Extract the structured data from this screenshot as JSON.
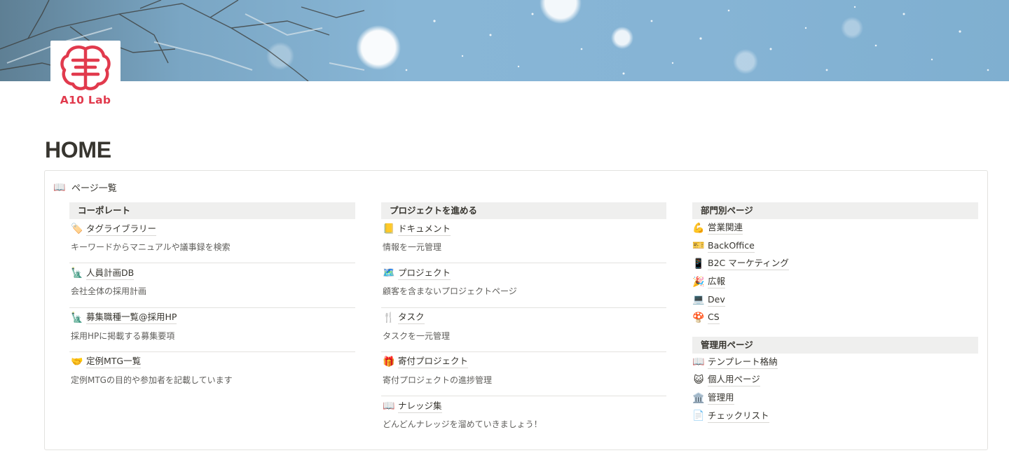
{
  "logo": {
    "text": "A10 Lab",
    "color": "#e13a4d"
  },
  "page": {
    "title": "HOME"
  },
  "overview": {
    "icon": "📖",
    "icon_name": "open-book-icon",
    "label": "ページ一覧"
  },
  "columns": [
    {
      "heading": "コーポレート",
      "items": [
        {
          "icon": "🏷️",
          "icon_name": "tag-icon",
          "title": "タグライブラリー",
          "desc": "キーワードからマニュアルや議事録を検索"
        },
        {
          "icon": "🗽",
          "icon_name": "statue-of-liberty-icon",
          "title": "人員計画DB",
          "desc": "会社全体の採用計画"
        },
        {
          "icon": "🗽",
          "icon_name": "statue-of-liberty-icon",
          "title": "募集職種一覧@採用HP",
          "desc": "採用HPに掲載する募集要項"
        },
        {
          "icon": "🤝",
          "icon_name": "handshake-icon",
          "title": "定例MTG一覧",
          "desc": "定例MTGの目的や参加者を記載しています"
        }
      ]
    },
    {
      "heading": "プロジェクトを進める",
      "items": [
        {
          "icon": "📒",
          "icon_name": "ledger-icon",
          "title": "ドキュメント",
          "desc": "情報を一元管理"
        },
        {
          "icon": "🗺️",
          "icon_name": "map-icon",
          "title": "プロジェクト",
          "desc": "顧客を含まないプロジェクトページ"
        },
        {
          "icon": "🍴",
          "icon_name": "fork-knife-icon",
          "title": "タスク",
          "desc": "タスクを一元管理"
        },
        {
          "icon": "🎁",
          "icon_name": "gift-icon",
          "title": "寄付プロジェクト",
          "desc": "寄付プロジェクトの進捗管理"
        },
        {
          "icon": "📖",
          "icon_name": "open-book-icon",
          "title": "ナレッジ集",
          "desc": "どんどんナレッジを溜めていきましょう！"
        }
      ]
    }
  ],
  "departments": {
    "heading": "部門別ページ",
    "links": [
      {
        "icon": "💪",
        "icon_name": "flexed-biceps-icon",
        "label": "営業関連"
      },
      {
        "icon": "🎫",
        "icon_name": "ticket-icon",
        "label": "BackOffice"
      },
      {
        "icon": "📱",
        "icon_name": "mobile-phone-icon",
        "label": "B2C マーケティング"
      },
      {
        "icon": "🎉",
        "icon_name": "party-popper-icon",
        "label": "広報"
      },
      {
        "icon": "💻",
        "icon_name": "laptop-icon",
        "label": "Dev"
      },
      {
        "icon": "🍄",
        "icon_name": "mushroom-icon",
        "label": "CS"
      }
    ]
  },
  "admin": {
    "heading": "管理用ページ",
    "links": [
      {
        "icon": "📖",
        "icon_name": "open-book-icon",
        "label": "テンプレート格納"
      },
      {
        "icon": "😺",
        "icon_name": "cat-face-icon",
        "label": "個人用ページ"
      },
      {
        "icon": "🏛️",
        "icon_name": "classical-building-icon",
        "label": "管理用"
      },
      {
        "icon": "📄",
        "icon_name": "document-icon",
        "label": "チェックリスト"
      }
    ]
  }
}
